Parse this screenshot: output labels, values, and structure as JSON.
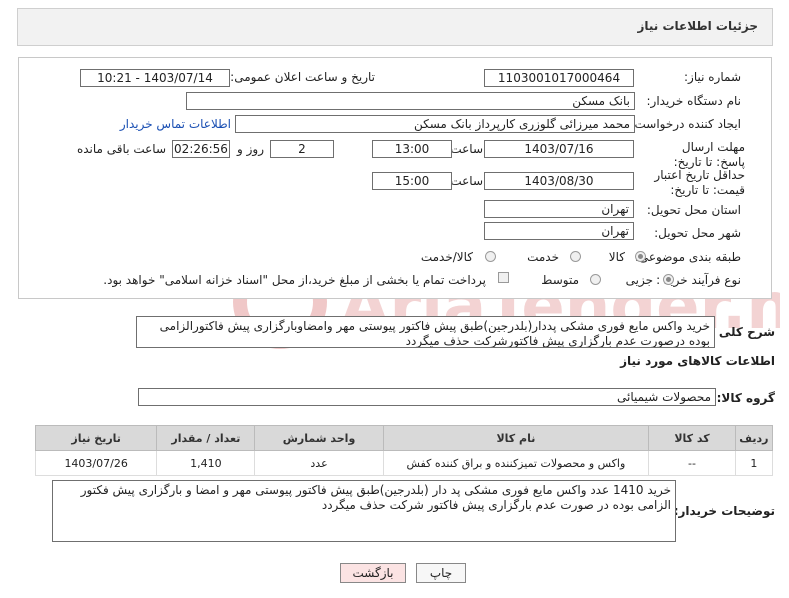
{
  "header": {
    "title": "جزئیات اطلاعات نیاز"
  },
  "form": {
    "need_number_label": "شماره نیاز:",
    "need_number": "1103001017000464",
    "announce_label": "تاریخ و ساعت اعلان عمومی:",
    "announce_value": "1403/07/14 - 10:21",
    "buyer_org_label": "نام دستگاه خریدار:",
    "buyer_org": "بانک مسکن",
    "creator_label": "ایجاد کننده درخواست:",
    "creator": "محمد میرزائی گلوزری کارپرداز بانک مسکن",
    "contact_link": "اطلاعات تماس خریدار",
    "deadline_label": "مهلت ارسال پاسخ: تا تاریخ:",
    "deadline_date": "1403/07/16",
    "time_label": "ساعت",
    "deadline_time": "13:00",
    "days_value": "2",
    "days_label": "روز و",
    "remaining_time": "02:26:56",
    "remaining_label": "ساعت باقی مانده",
    "validity_label": "حداقل تاریخ اعتبار قیمت: تا تاریخ:",
    "validity_date": "1403/08/30",
    "validity_time": "15:00",
    "province_label": "استان محل تحویل:",
    "province": "تهران",
    "city_label": "شهر محل تحویل:",
    "city": "تهران",
    "category_label": "طبقه بندی موضوعی:",
    "category_options": [
      "کالا",
      "خدمت",
      "کالا/خدمت"
    ],
    "process_label": "نوع فرآیند خرید :",
    "process_options": [
      "جزیی",
      "متوسط"
    ],
    "payment_note": "پرداخت تمام یا بخشی از مبلغ خرید،از محل \"اسناد خزانه اسلامی\" خواهد بود."
  },
  "description": {
    "label": "شرح کلی نیاز:",
    "text": "خرید واکس مایع فوری مشکی پددار(بلدرجین)طبق پیش فاکتور پیوستی مهر وامضاوبارگزاری پیش فاکتورالزامی بوده درصورت عدم بارگزاری پیش فاکتورشرکت حذف میگردد"
  },
  "goods": {
    "section_title": "اطلاعات کالاهای مورد نیاز",
    "group_label": "گروه کالا:",
    "group_value": "محصولات شیمیائی",
    "columns": [
      "ردیف",
      "کد کالا",
      "نام کالا",
      "واحد شمارش",
      "تعداد / مقدار",
      "تاریخ نیاز"
    ],
    "rows": [
      [
        "1",
        "--",
        "واکس و محصولات تمیزکننده و براق کننده کفش",
        "عدد",
        "1,410",
        "1403/07/26"
      ]
    ]
  },
  "buyer_notes": {
    "label": "توضیحات خریدار:",
    "text": "خرید 1410 عدد واکس مایع فوری مشکی پد دار (بلدرجین)طبق پیش فاکتور پیوستی مهر و امضا و بارگزاری پیش فکتور الزامی بوده در صورت عدم بارگزاری پیش فاکتور شرکت حذف میگردد"
  },
  "buttons": {
    "print": "چاپ",
    "back": "بازگشت"
  },
  "watermark": {
    "text": "AriaTender.neT"
  },
  "colors": {
    "back_button_bg": "#fbe3e3",
    "watermark": "#f0c8c8",
    "link": "#1a4fb3"
  }
}
